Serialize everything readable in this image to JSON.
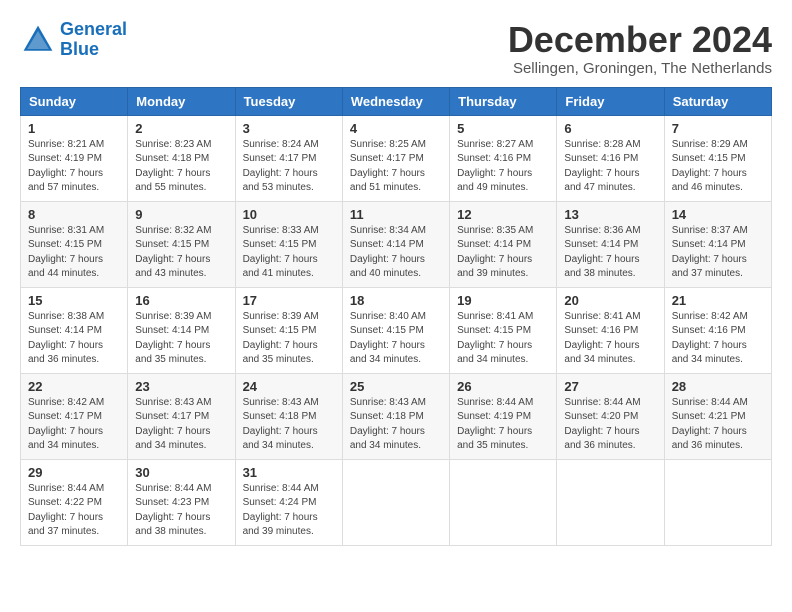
{
  "logo": {
    "line1": "General",
    "line2": "Blue"
  },
  "title": "December 2024",
  "subtitle": "Sellingen, Groningen, The Netherlands",
  "headers": [
    "Sunday",
    "Monday",
    "Tuesday",
    "Wednesday",
    "Thursday",
    "Friday",
    "Saturday"
  ],
  "weeks": [
    [
      {
        "day": "1",
        "text": "Sunrise: 8:21 AM\nSunset: 4:19 PM\nDaylight: 7 hours\nand 57 minutes."
      },
      {
        "day": "2",
        "text": "Sunrise: 8:23 AM\nSunset: 4:18 PM\nDaylight: 7 hours\nand 55 minutes."
      },
      {
        "day": "3",
        "text": "Sunrise: 8:24 AM\nSunset: 4:17 PM\nDaylight: 7 hours\nand 53 minutes."
      },
      {
        "day": "4",
        "text": "Sunrise: 8:25 AM\nSunset: 4:17 PM\nDaylight: 7 hours\nand 51 minutes."
      },
      {
        "day": "5",
        "text": "Sunrise: 8:27 AM\nSunset: 4:16 PM\nDaylight: 7 hours\nand 49 minutes."
      },
      {
        "day": "6",
        "text": "Sunrise: 8:28 AM\nSunset: 4:16 PM\nDaylight: 7 hours\nand 47 minutes."
      },
      {
        "day": "7",
        "text": "Sunrise: 8:29 AM\nSunset: 4:15 PM\nDaylight: 7 hours\nand 46 minutes."
      }
    ],
    [
      {
        "day": "8",
        "text": "Sunrise: 8:31 AM\nSunset: 4:15 PM\nDaylight: 7 hours\nand 44 minutes."
      },
      {
        "day": "9",
        "text": "Sunrise: 8:32 AM\nSunset: 4:15 PM\nDaylight: 7 hours\nand 43 minutes."
      },
      {
        "day": "10",
        "text": "Sunrise: 8:33 AM\nSunset: 4:15 PM\nDaylight: 7 hours\nand 41 minutes."
      },
      {
        "day": "11",
        "text": "Sunrise: 8:34 AM\nSunset: 4:14 PM\nDaylight: 7 hours\nand 40 minutes."
      },
      {
        "day": "12",
        "text": "Sunrise: 8:35 AM\nSunset: 4:14 PM\nDaylight: 7 hours\nand 39 minutes."
      },
      {
        "day": "13",
        "text": "Sunrise: 8:36 AM\nSunset: 4:14 PM\nDaylight: 7 hours\nand 38 minutes."
      },
      {
        "day": "14",
        "text": "Sunrise: 8:37 AM\nSunset: 4:14 PM\nDaylight: 7 hours\nand 37 minutes."
      }
    ],
    [
      {
        "day": "15",
        "text": "Sunrise: 8:38 AM\nSunset: 4:14 PM\nDaylight: 7 hours\nand 36 minutes."
      },
      {
        "day": "16",
        "text": "Sunrise: 8:39 AM\nSunset: 4:14 PM\nDaylight: 7 hours\nand 35 minutes."
      },
      {
        "day": "17",
        "text": "Sunrise: 8:39 AM\nSunset: 4:15 PM\nDaylight: 7 hours\nand 35 minutes."
      },
      {
        "day": "18",
        "text": "Sunrise: 8:40 AM\nSunset: 4:15 PM\nDaylight: 7 hours\nand 34 minutes."
      },
      {
        "day": "19",
        "text": "Sunrise: 8:41 AM\nSunset: 4:15 PM\nDaylight: 7 hours\nand 34 minutes."
      },
      {
        "day": "20",
        "text": "Sunrise: 8:41 AM\nSunset: 4:16 PM\nDaylight: 7 hours\nand 34 minutes."
      },
      {
        "day": "21",
        "text": "Sunrise: 8:42 AM\nSunset: 4:16 PM\nDaylight: 7 hours\nand 34 minutes."
      }
    ],
    [
      {
        "day": "22",
        "text": "Sunrise: 8:42 AM\nSunset: 4:17 PM\nDaylight: 7 hours\nand 34 minutes."
      },
      {
        "day": "23",
        "text": "Sunrise: 8:43 AM\nSunset: 4:17 PM\nDaylight: 7 hours\nand 34 minutes."
      },
      {
        "day": "24",
        "text": "Sunrise: 8:43 AM\nSunset: 4:18 PM\nDaylight: 7 hours\nand 34 minutes."
      },
      {
        "day": "25",
        "text": "Sunrise: 8:43 AM\nSunset: 4:18 PM\nDaylight: 7 hours\nand 34 minutes."
      },
      {
        "day": "26",
        "text": "Sunrise: 8:44 AM\nSunset: 4:19 PM\nDaylight: 7 hours\nand 35 minutes."
      },
      {
        "day": "27",
        "text": "Sunrise: 8:44 AM\nSunset: 4:20 PM\nDaylight: 7 hours\nand 36 minutes."
      },
      {
        "day": "28",
        "text": "Sunrise: 8:44 AM\nSunset: 4:21 PM\nDaylight: 7 hours\nand 36 minutes."
      }
    ],
    [
      {
        "day": "29",
        "text": "Sunrise: 8:44 AM\nSunset: 4:22 PM\nDaylight: 7 hours\nand 37 minutes."
      },
      {
        "day": "30",
        "text": "Sunrise: 8:44 AM\nSunset: 4:23 PM\nDaylight: 7 hours\nand 38 minutes."
      },
      {
        "day": "31",
        "text": "Sunrise: 8:44 AM\nSunset: 4:24 PM\nDaylight: 7 hours\nand 39 minutes."
      },
      null,
      null,
      null,
      null
    ]
  ]
}
